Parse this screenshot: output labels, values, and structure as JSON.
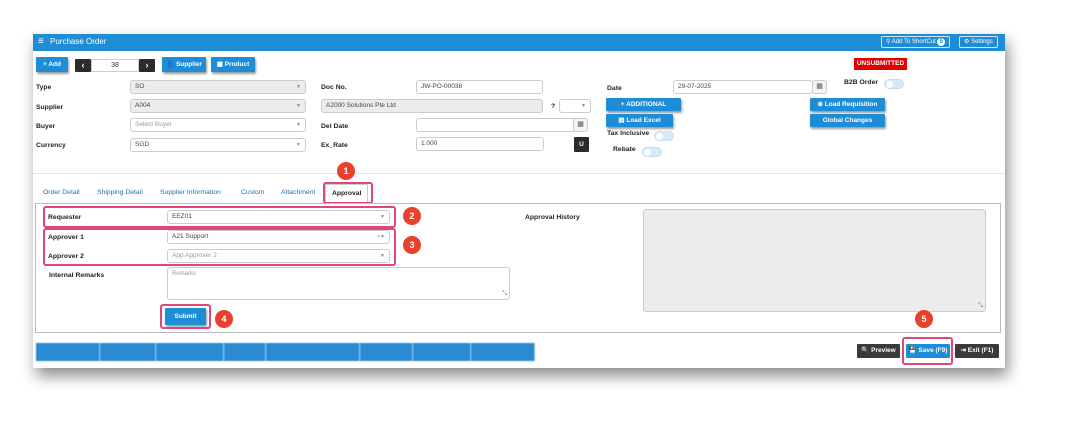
{
  "window": {
    "title": "Purchase Order",
    "add_to_shortcut": "Add To ShortCut",
    "shortcut_count": "5",
    "settings": "Settings"
  },
  "toolbar": {
    "add": "+ Add",
    "prev": "‹",
    "record_number": "38",
    "next": "›",
    "supplier": "Supplier",
    "product": "Product"
  },
  "status": "UNSUBMITTED",
  "header": {
    "type_label": "Type",
    "type_value": "SO",
    "supplier_label": "Supplier",
    "supplier_value": "A004",
    "buyer_label": "Buyer",
    "buyer_placeholder": "Select Buyer",
    "currency_label": "Currency",
    "currency_value": "SGD",
    "docno_label": "Doc No.",
    "docno_value": "JW-PO-00038",
    "supplier_name": "A2000 Solutions Pte Ltd",
    "question": "?",
    "deldate_label": "Del Date",
    "exrate_label": "Ex_Rate",
    "exrate_value": "1.000",
    "u_button": "U",
    "date_label": "Date",
    "date_value": "29-07-2025",
    "b2b_label": "B2B Order",
    "additional": "+ ADDITIONAL",
    "load_excel": "Load Excel",
    "tax_inclusive": "Tax Inclusive",
    "rebate": "Rebate",
    "load_requisition": "Load Requisition",
    "global_changes": "Global Changes"
  },
  "tabs": [
    "Order Detail",
    "Shipping Detail",
    "Supplier Information",
    "Custom",
    "Attachment",
    "Approval"
  ],
  "approval": {
    "requester_label": "Requester",
    "requester_value": "EEZ01",
    "approver1_label": "Approver 1",
    "approver1_value": "A21 Support",
    "approver2_label": "Approver 2",
    "approver2_placeholder": "App Approver 2",
    "remarks_label": "Internal Remarks",
    "remarks_placeholder": "Remarks",
    "history_label": "Approval History",
    "submit": "Submit"
  },
  "callouts": [
    "1",
    "2",
    "3",
    "4",
    "5"
  ],
  "footer": {
    "preview": "Preview",
    "save": "Save (F9)",
    "exit": "Exit (F1)"
  },
  "colors": {
    "accent": "#1f8dd6",
    "status_red": "#e00000",
    "highlight": "#e0457b",
    "callout": "#e8412c"
  }
}
